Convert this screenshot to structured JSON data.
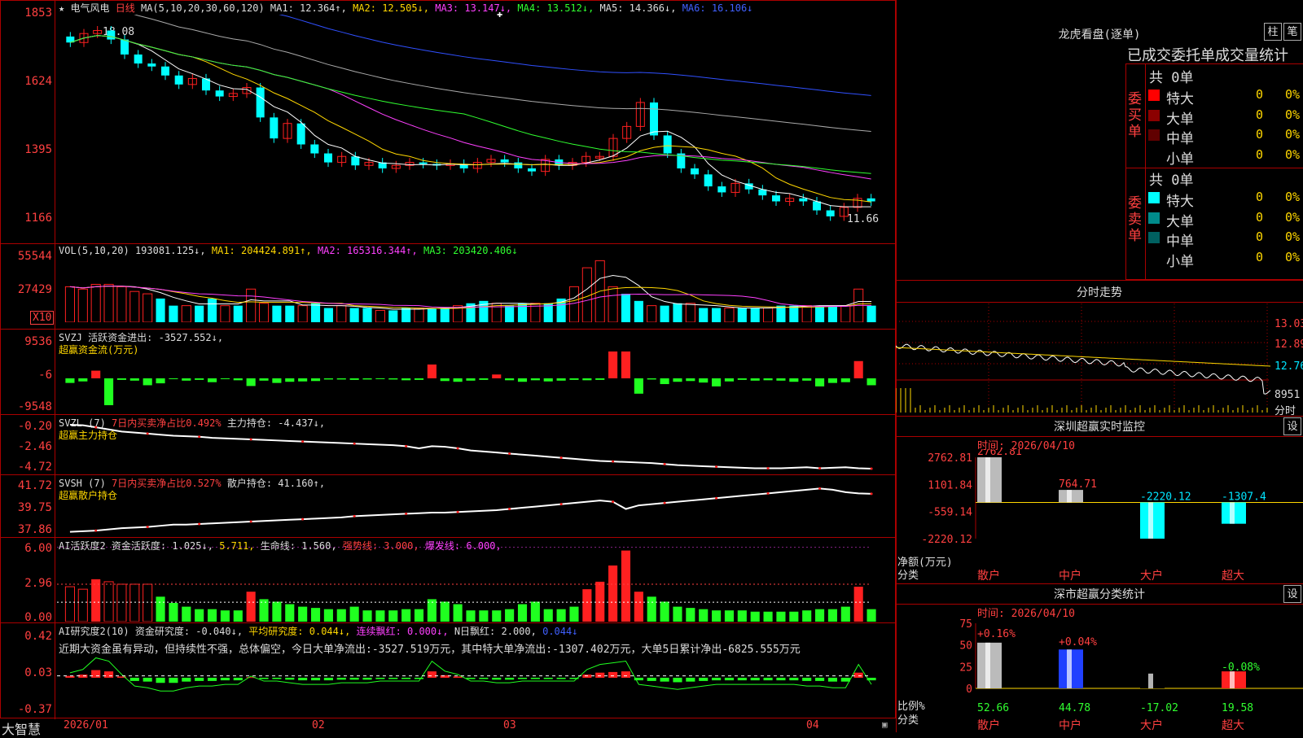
{
  "header": {
    "star_glyph": "★",
    "stock_name": "电气风电",
    "period_label": "日线",
    "ma_prefix": "MA(5,10,20,30,60,120)",
    "ma1": "MA1: 12.364↑,",
    "ma2": "MA2: 12.505↓,",
    "ma3": "MA3: 13.147↓,",
    "ma4": "MA4: 13.512↓,",
    "ma5": "MA5: 14.366↓,",
    "ma6": "MA6: 16.106↓"
  },
  "main_axis": {
    "labels": [
      "1853",
      "1624",
      "1395",
      "1166"
    ],
    "high_note": "18.08",
    "low_note": "11.66"
  },
  "vol": {
    "axis_labels": [
      "55544",
      "27429"
    ],
    "unit_badge": "X10",
    "prefix": "VOL(5,10,20)",
    "value": "193081.125↓,",
    "ma1": "MA1: 204424.891↑,",
    "ma2": "MA2: 165316.344↑,",
    "ma3": "MA3: 203420.406↓"
  },
  "svzj": {
    "axis_labels": [
      "9536",
      "-6",
      "-9548"
    ],
    "line1_prefix": "SVZJ",
    "line1_text": "活跃资金进出: -3527.552↓,",
    "line2": "超赢资金流(万元)"
  },
  "svzl": {
    "axis_labels": [
      "-0.20",
      "-2.46",
      "-4.72"
    ],
    "prefix": "SVZL (7)",
    "ratio": "7日内买卖净占比0.492%",
    "holding": "主力持仓: -4.437↓,",
    "line2": "超赢主力持仓"
  },
  "svsh": {
    "axis_labels": [
      "41.72",
      "39.75",
      "37.86"
    ],
    "prefix": "SVSH (7)",
    "ratio": "7日内买卖净占比0.527%",
    "holding": "散户持仓: 41.160↑,",
    "line2": "超赢散户持仓"
  },
  "ai_active": {
    "axis_labels": [
      "6.00",
      "2.96",
      "0.00"
    ],
    "prefix": "AI活跃度2",
    "activity": "资金活跃度: 1.025↓,",
    "v2": "5.711,",
    "life": "生命线: 1.560,",
    "strong": "强势线: 3.000,",
    "burst": "爆发线: 6.000,"
  },
  "ai_research": {
    "axis_labels": [
      "0.42",
      "0.03",
      "-0.37"
    ],
    "prefix": "AI研究度2(10)",
    "research": "资金研究度: -0.040↓,",
    "avg": "平均研究度: 0.044↓,",
    "lianxu": "连续飘红: 0.000↓,",
    "nday": "N日飘红: 2.000,",
    "v5": "0.044↓",
    "comment": "近期大资金虽有异动，但持续性不强，总体偏空，今日大单净流出:-3527.519万元，其中特大单净流出:-1307.402万元，大单5日累计净出-6825.555万元"
  },
  "bottom_bar": {
    "brand": "大智慧",
    "dates": [
      "2026/01",
      "02",
      "03",
      "04"
    ]
  },
  "dragon_tiger": {
    "title": "龙虎看盘(逐单)",
    "btn_col": "柱",
    "btn_pen": "笔",
    "subtitle": "已成交委托单成交量统计",
    "buy_label": "委买单",
    "sell_label": "委卖单",
    "buy_total": "共 0单",
    "sell_total": "共 0单",
    "buy_rows": [
      {
        "label": "特大",
        "count": "0",
        "pct": "0%",
        "color": "#ff0000"
      },
      {
        "label": "大单",
        "count": "0",
        "pct": "0%",
        "color": "#8b0000"
      },
      {
        "label": "中单",
        "count": "0",
        "pct": "0%",
        "color": "#600000"
      },
      {
        "label": "小单",
        "count": "0",
        "pct": "0%",
        "color": "#000000"
      }
    ],
    "sell_rows": [
      {
        "label": "特大",
        "count": "0",
        "pct": "0%",
        "color": "#00ffff"
      },
      {
        "label": "大单",
        "count": "0",
        "pct": "0%",
        "color": "#008b8b"
      },
      {
        "label": "中单",
        "count": "0",
        "pct": "0%",
        "color": "#006060"
      },
      {
        "label": "小单",
        "count": "0",
        "pct": "0%",
        "color": "#000000"
      }
    ]
  },
  "intraday": {
    "title": "分时走势",
    "prices": [
      "13.03",
      "12.89",
      "12.76"
    ],
    "volume": "8951",
    "vol_label": "分时"
  },
  "sz_monitor": {
    "title": "深圳超赢实时监控",
    "btn": "设",
    "time": "时间: 2026/04/10",
    "y_labels": [
      "2762.81",
      "1101.84",
      "-559.14",
      "-2220.12"
    ],
    "ylabel_line1": "净额(万元)",
    "ylabel_line2": "分类"
  },
  "sz_category": {
    "title": "深市超赢分类统计",
    "btn": "设",
    "time": "时间: 2026/04/10",
    "y_labels": [
      "75",
      "50",
      "25",
      "0"
    ],
    "ylabel_line1": "比例%",
    "ylabel_line2": "分类",
    "pct_labels": [
      "+0.16%",
      "+0.04%",
      "-0.08%"
    ]
  },
  "chart_data": [
    {
      "type": "candlestick",
      "title": "电气风电 日线",
      "x": [
        "2026/01",
        "02",
        "03",
        "04"
      ],
      "ylim": [
        11.66,
        18.53
      ],
      "high": 18.08,
      "low": 11.66,
      "ma": {
        "MA1": 12.364,
        "MA2": 12.505,
        "MA3": 13.147,
        "MA4": 13.512,
        "MA5": 14.366,
        "MA6": 16.106
      },
      "close": [
        17.6,
        17.9,
        18.0,
        17.7,
        17.2,
        16.9,
        16.8,
        16.5,
        16.2,
        16.4,
        16.0,
        15.8,
        15.9,
        16.1,
        15.1,
        14.4,
        14.9,
        14.2,
        13.9,
        13.6,
        13.8,
        13.5,
        13.6,
        13.4,
        13.5,
        13.6,
        13.55,
        13.5,
        13.55,
        13.4,
        13.6,
        13.7,
        13.6,
        13.4,
        13.3,
        13.7,
        13.5,
        13.6,
        13.8,
        13.8,
        14.4,
        14.8,
        15.6,
        14.5,
        13.9,
        13.4,
        13.2,
        12.8,
        12.6,
        12.9,
        12.7,
        12.5,
        12.3,
        12.4,
        12.3,
        12.0,
        11.8,
        12.1,
        12.4,
        12.3
      ]
    },
    {
      "type": "bar",
      "title": "VOL(5,10,20)",
      "ylim": [
        0,
        55544
      ],
      "values": [
        30,
        28,
        32,
        32,
        30,
        26,
        24,
        20,
        14,
        14,
        14,
        20,
        14,
        14,
        28,
        16,
        14,
        14,
        14,
        16,
        12,
        14,
        12,
        12,
        10,
        10,
        12,
        12,
        12,
        12,
        14,
        16,
        18,
        16,
        14,
        16,
        16,
        16,
        20,
        30,
        46,
        52,
        30,
        24,
        18,
        14,
        14,
        16,
        16,
        12,
        12,
        12,
        12,
        12,
        12,
        14,
        14,
        14,
        14,
        14,
        14,
        28,
        14
      ]
    },
    {
      "type": "bar",
      "title": "SVZJ 超赢资金流(万元)",
      "ylim": [
        -9548,
        9536
      ],
      "values": [
        -1200,
        -800,
        2000,
        -7000,
        -400,
        -600,
        -1800,
        -1300,
        -200,
        -600,
        -400,
        -1000,
        -200,
        -500,
        -2000,
        -600,
        -1200,
        -900,
        -800,
        -700,
        -300,
        -300,
        -400,
        -300,
        -200,
        -300,
        -500,
        -400,
        3600,
        -700,
        -900,
        -600,
        -400,
        1000,
        -500,
        -900,
        -500,
        -800,
        -600,
        -400,
        -500,
        -400,
        7000,
        7000,
        -4000,
        -300,
        -1500,
        -900,
        -700,
        -1100,
        -2100,
        -800,
        -400,
        -600,
        -500,
        -600,
        -900,
        -600,
        -2100,
        -1200,
        -1000,
        4500,
        -1800
      ]
    },
    {
      "type": "line",
      "title": "SVZL 主力持仓",
      "ylim": [
        -4.72,
        -0.2
      ],
      "values": [
        -0.25,
        -0.3,
        -0.5,
        -0.7,
        -0.9,
        -1.0,
        -1.1,
        -1.2,
        -1.3,
        -1.35,
        -1.4,
        -1.5,
        -1.55,
        -1.6,
        -1.65,
        -1.7,
        -1.75,
        -1.8,
        -1.85,
        -1.9,
        -1.95,
        -2.0,
        -2.05,
        -2.1,
        -2.15,
        -2.2,
        -2.3,
        -2.5,
        -2.3,
        -2.35,
        -2.5,
        -2.7,
        -2.8,
        -2.9,
        -3.0,
        -3.1,
        -3.2,
        -3.3,
        -3.4,
        -3.5,
        -3.6,
        -3.7,
        -3.75,
        -3.8,
        -3.85,
        -3.9,
        -4.0,
        -4.1,
        -4.15,
        -4.2,
        -4.25,
        -4.3,
        -4.35,
        -4.4,
        -4.4,
        -4.4,
        -4.35,
        -4.3,
        -4.4,
        -4.35,
        -4.3,
        -4.4,
        -4.437
      ]
    },
    {
      "type": "line",
      "title": "SVSH 散户持仓",
      "ylim": [
        37.86,
        41.72
      ],
      "values": [
        38.0,
        38.05,
        38.1,
        38.2,
        38.3,
        38.35,
        38.4,
        38.5,
        38.6,
        38.6,
        38.65,
        38.7,
        38.75,
        38.8,
        38.85,
        38.9,
        38.95,
        39.0,
        39.05,
        39.1,
        39.15,
        39.2,
        39.3,
        39.35,
        39.4,
        39.45,
        39.5,
        39.55,
        39.6,
        39.6,
        39.65,
        39.7,
        39.75,
        39.8,
        39.9,
        40.0,
        40.1,
        40.2,
        40.3,
        40.4,
        40.5,
        40.6,
        40.5,
        39.9,
        40.2,
        40.3,
        40.4,
        40.5,
        40.6,
        40.7,
        40.8,
        40.9,
        41.0,
        41.1,
        41.2,
        41.3,
        41.4,
        41.5,
        41.6,
        41.5,
        41.3,
        41.2,
        41.16
      ]
    },
    {
      "type": "bar",
      "title": "AI活跃度2",
      "ylim": [
        0,
        6.0
      ],
      "values": [
        2.8,
        2.6,
        3.4,
        3.2,
        3.0,
        3.0,
        3.0,
        2.0,
        1.5,
        1.2,
        1.0,
        1.0,
        0.9,
        0.9,
        2.4,
        1.8,
        1.6,
        1.4,
        1.2,
        1.1,
        1.0,
        1.0,
        1.2,
        0.9,
        0.9,
        0.9,
        1.0,
        1.0,
        1.8,
        1.6,
        1.4,
        0.9,
        0.9,
        0.9,
        1.0,
        1.4,
        1.6,
        1.0,
        1.0,
        1.2,
        2.6,
        3.2,
        4.5,
        5.7,
        2.4,
        2.0,
        1.6,
        1.2,
        1.1,
        1.0,
        0.9,
        0.9,
        0.9,
        0.8,
        0.8,
        0.8,
        0.8,
        0.9,
        1.0,
        1.0,
        1.2,
        2.8,
        1.0
      ]
    },
    {
      "type": "bar",
      "title": "AI研究度2(10)",
      "ylim": [
        -0.37,
        0.42
      ],
      "values": [
        0.03,
        0.05,
        0.12,
        0.1,
        0.02,
        -0.05,
        -0.06,
        -0.08,
        -0.08,
        -0.06,
        -0.05,
        -0.05,
        -0.04,
        -0.04,
        0.01,
        -0.02,
        -0.02,
        -0.03,
        -0.04,
        -0.04,
        -0.04,
        -0.03,
        -0.03,
        -0.03,
        -0.02,
        -0.02,
        -0.02,
        -0.02,
        0.1,
        0.04,
        0.02,
        -0.02,
        -0.02,
        -0.03,
        -0.03,
        -0.02,
        -0.02,
        -0.02,
        -0.02,
        -0.02,
        0.05,
        0.08,
        0.09,
        0.1,
        -0.04,
        -0.05,
        -0.06,
        -0.07,
        -0.06,
        -0.05,
        -0.04,
        -0.04,
        -0.04,
        -0.04,
        -0.04,
        -0.04,
        -0.04,
        -0.05,
        -0.05,
        -0.06,
        -0.06,
        0.08,
        -0.04
      ]
    },
    {
      "type": "bar",
      "title": "深圳超赢实时监控",
      "categories": [
        "散户",
        "中户",
        "大户",
        "超大"
      ],
      "values": [
        2762.81,
        764.71,
        -2220.12,
        -1307.4
      ],
      "ylabel": "净额(万元)",
      "ylim": [
        -2220.12,
        2762.81
      ]
    },
    {
      "type": "bar",
      "title": "深市超赢分类统计",
      "categories": [
        "散户",
        "中户",
        "大户",
        "超大"
      ],
      "values": [
        52.66,
        44.78,
        -17.02,
        19.58
      ],
      "ylabel": "比例%",
      "ylim": [
        0,
        75
      ]
    }
  ]
}
